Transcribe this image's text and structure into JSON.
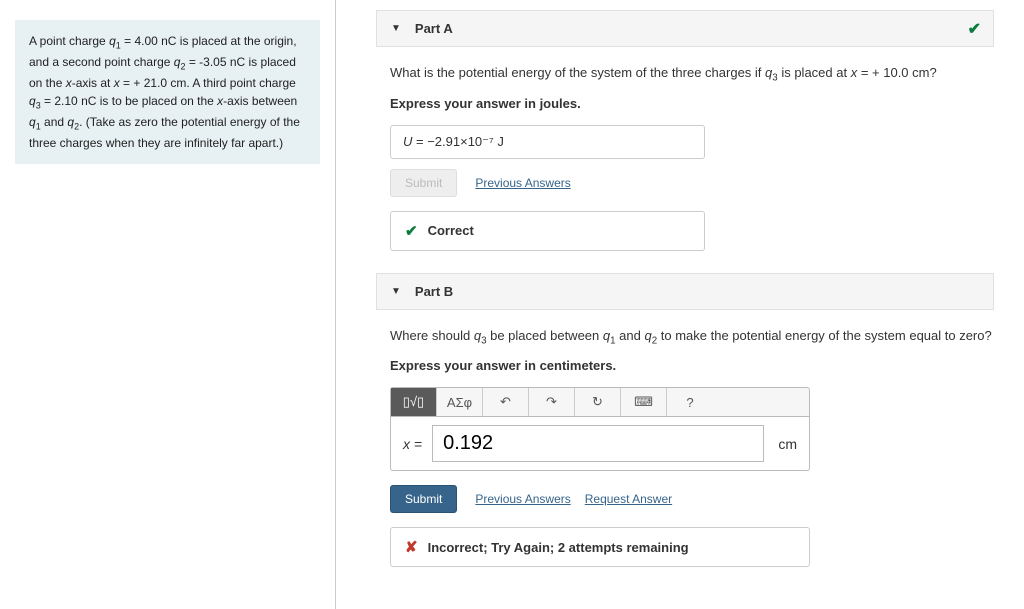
{
  "problem_statement": "A point charge q₁ = 4.00 nC is placed at the origin, and a second point charge q₂ = -3.05 nC is placed on the x-axis at x = + 21.0 cm. A third point charge q₃ = 2.10 nC is to be placed on the x-axis between q₁ and q₂. (Take as zero the potential energy of the three charges when they are infinitely far apart.)",
  "part_a": {
    "label": "Part A",
    "question_prefix": "What is the potential energy of the system of the three charges if ",
    "q3": "q₃",
    "question_mid": " is placed at ",
    "xeq": "x = + 10.0 cm",
    "question_suffix": "?",
    "instruction": "Express your answer in joules.",
    "answer_lhs": "U",
    "answer_value": "−2.91×10⁻⁷  J",
    "submit": "Submit",
    "prev_answers": "Previous Answers",
    "feedback": "Correct"
  },
  "part_b": {
    "label": "Part B",
    "question_prefix": "Where should ",
    "q3": "q₃",
    "question_mid1": " be placed between ",
    "q1": "q₁",
    "and": " and ",
    "q2": "q₂",
    "question_suffix": " to make the potential energy of the system equal to zero?",
    "instruction": "Express your answer in centimeters.",
    "toolbar": {
      "templates": "▯√▯",
      "greek": "ΑΣφ",
      "undo": "↶",
      "redo": "↷",
      "reset": "↻",
      "keyboard": "⌨",
      "help": "?"
    },
    "lhs": "x =",
    "value": "0.192",
    "unit": "cm",
    "submit": "Submit",
    "prev_answers": "Previous Answers",
    "request_answer": "Request Answer",
    "feedback": "Incorrect; Try Again; 2 attempts remaining"
  }
}
